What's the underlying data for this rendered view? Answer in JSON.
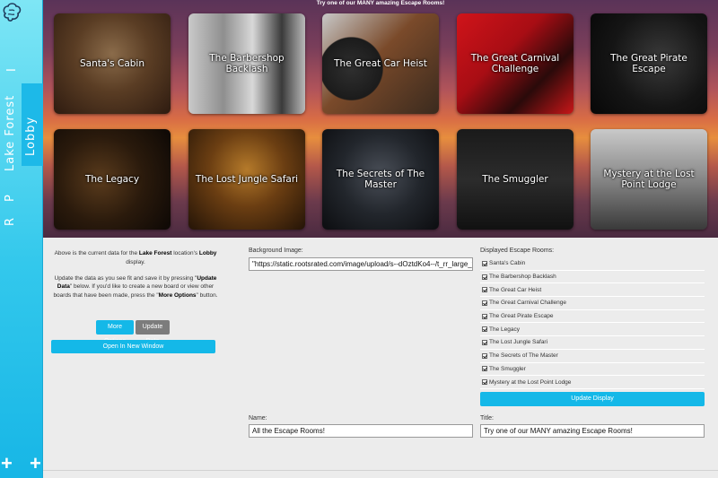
{
  "sidebar": {
    "location": "Lake Forest",
    "board": "Lobby",
    "items": [
      "I",
      "P",
      "R"
    ],
    "add_left": "+",
    "add_right": "+"
  },
  "board": {
    "title": "Try one of our MANY amazing Escape Rooms!",
    "rooms": [
      "Santa's Cabin",
      "The Barbershop Backlash",
      "The Great Car Heist",
      "The Great Carnival Challenge",
      "The Great Pirate Escape",
      "The Legacy",
      "The Lost Jungle Safari",
      "The Secrets of The Master",
      "The Smuggler",
      "Mystery at the Lost Point Lodge"
    ]
  },
  "info": {
    "line1_prefix": "Above is the current data for the ",
    "location": "Lake Forest",
    "line1_mid": " location's ",
    "board": "Lobby",
    "line1_suffix": " display.",
    "line2_prefix": "Update the data as you see fit and save it by pressing \"",
    "update_data": "Update Data",
    "line2_mid": "\" below. If you'd like to create a new board or view other boards that have been made, press the \"",
    "more_options": "More Options",
    "line2_suffix": "\" button."
  },
  "buttons": {
    "more_options": "More Options",
    "update_data": "Update Data",
    "open_new_window": "Open In New Window",
    "update_display": "Update Display"
  },
  "form": {
    "background_label": "Background Image:",
    "background_value": "\"https://static.rootsrated.com/image/upload/s--dOztdKo4--/t_rr_large_trad",
    "displayed_label": "Displayed Escape Rooms:",
    "name_label": "Name:",
    "name_value": "All the Escape Rooms!",
    "title_label": "Title:",
    "title_value": "Try one of our MANY amazing Escape Rooms!"
  },
  "colors": {
    "accent": "#14b8e8",
    "sidebar": "#33c8ec",
    "secondary_button": "#7c7c7c"
  }
}
